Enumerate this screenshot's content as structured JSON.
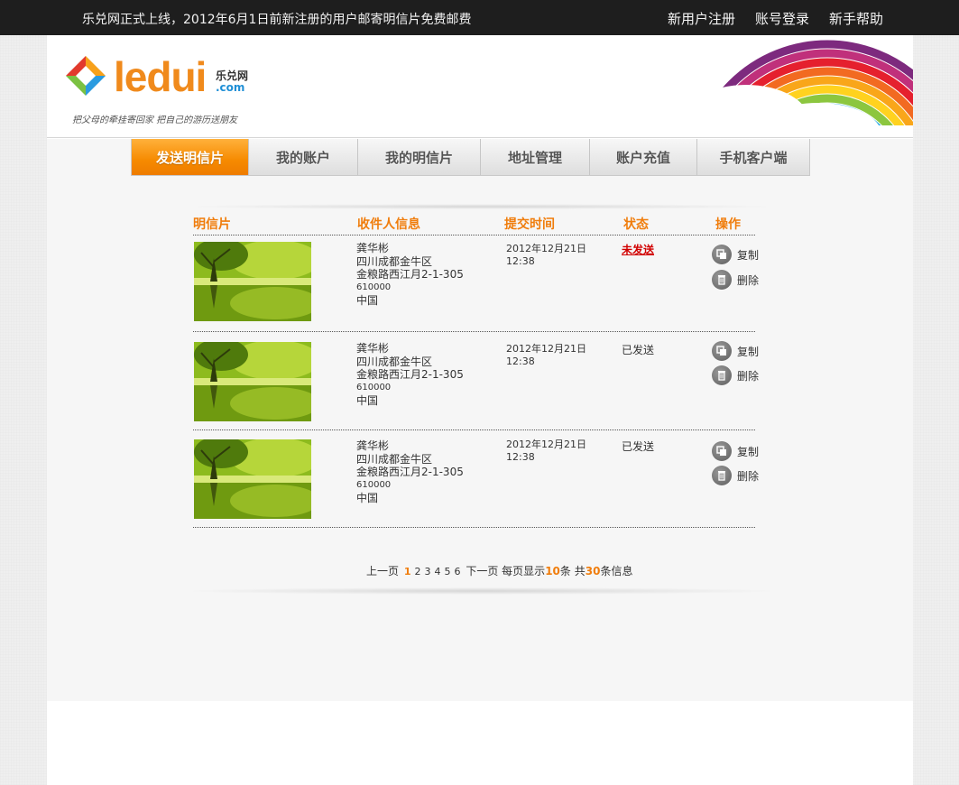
{
  "topbar": {
    "notice": "乐兑网正式上线，2012年6月1日前新注册的用户邮寄明信片免费邮费",
    "links": [
      "新用户注册",
      "账号登录",
      "新手帮助"
    ]
  },
  "logo": {
    "word": "ledui",
    "cn": "乐兑网",
    "com": ".com",
    "slogan": "把父母的牵挂寄回家  把自己的游历送朋友"
  },
  "nav": {
    "tabs": [
      "发送明信片",
      "我的账户",
      "我的明信片",
      "地址管理",
      "账户充值",
      "手机客户端"
    ],
    "active_index": 0
  },
  "table": {
    "headers": {
      "postcard": "明信片",
      "recipient": "收件人信息",
      "time": "提交时间",
      "status": "状态",
      "ops": "操作"
    },
    "rows": [
      {
        "name": "龚华彬",
        "line1": "四川成都金牛区",
        "line2": "金粮路西江月2-1-305",
        "zip": "610000",
        "country": "中国",
        "date": "2012年12月21日",
        "clock": "12:38",
        "status": "未发送",
        "copy": "复制",
        "delete": "删除"
      },
      {
        "name": "龚华彬",
        "line1": "四川成都金牛区",
        "line2": "金粮路西江月2-1-305",
        "zip": "610000",
        "country": "中国",
        "date": "2012年12月21日",
        "clock": "12:38",
        "status": "已发送",
        "copy": "复制",
        "delete": "删除"
      },
      {
        "name": "龚华彬",
        "line1": "四川成都金牛区",
        "line2": "金粮路西江月2-1-305",
        "zip": "610000",
        "country": "中国",
        "date": "2012年12月21日",
        "clock": "12:38",
        "status": "已发送",
        "copy": "复制",
        "delete": "删除"
      }
    ]
  },
  "pager": {
    "prev": "上一页",
    "pages": [
      "1",
      "2",
      "3",
      "4",
      "5",
      "6"
    ],
    "current": "1",
    "next": "下一页",
    "per_page_label": "每页显示",
    "per_page": "10",
    "per_page_unit": "条",
    "total_label": "共",
    "total": "30",
    "total_unit": "条信息"
  },
  "colors": {
    "accent": "#f07d0c",
    "unsent": "#d10000",
    "topbar": "#1e1e1e"
  }
}
